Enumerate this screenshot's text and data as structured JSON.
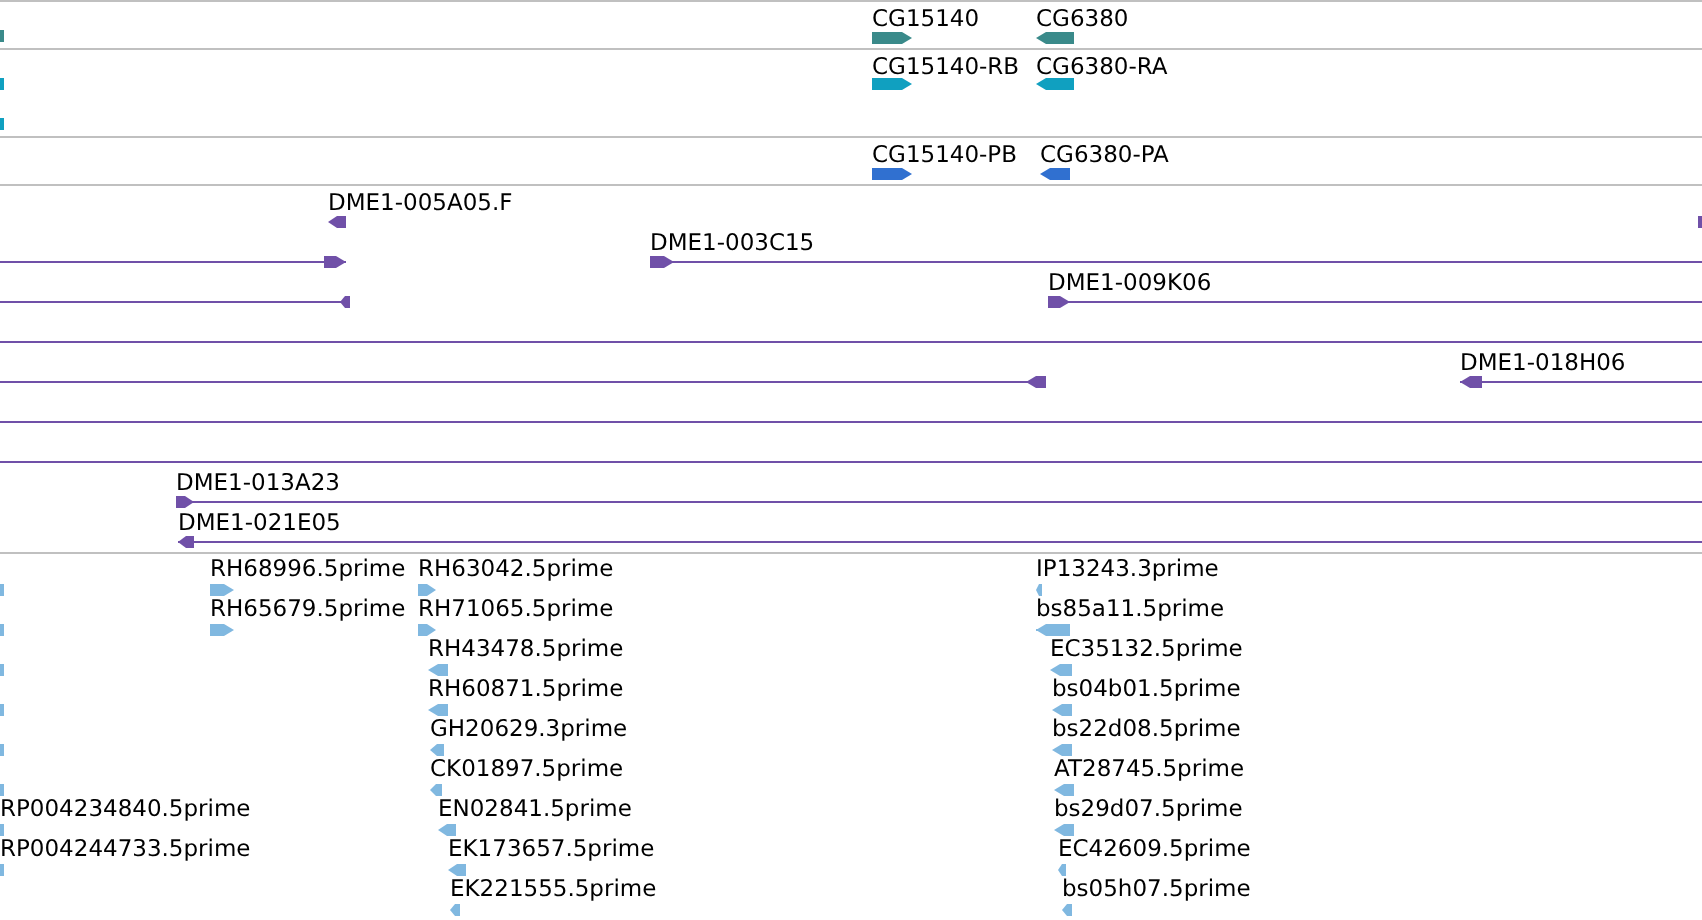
{
  "tracks": [
    {
      "kind": "gene",
      "features": [
        {
          "kind": "stub"
        },
        {
          "kind": "arrow",
          "label": "CG15140",
          "reverse": false
        },
        {
          "kind": "arrow",
          "label": "CG6380",
          "reverse": true
        }
      ]
    },
    {
      "kind": "transcript",
      "features": [
        {
          "kind": "stub"
        },
        {
          "kind": "stub"
        },
        {
          "kind": "arrow",
          "label": "CG15140-RB",
          "reverse": false
        },
        {
          "kind": "arrow",
          "label": "CG6380-RA",
          "reverse": true
        }
      ]
    },
    {
      "kind": "protein",
      "features": [
        {
          "kind": "arrow",
          "label": "CG15140-PB",
          "reverse": false
        },
        {
          "kind": "arrow",
          "label": "CG6380-PA",
          "reverse": true
        }
      ]
    },
    {
      "kind": "clone",
      "features": [
        {
          "kind": "arrow",
          "label": "DME1-005A05.F",
          "reverse": true
        },
        {
          "kind": "stub"
        },
        {
          "kind": "arrow",
          "reverse": false
        },
        {
          "kind": "arrow",
          "label": "DME1-003C15",
          "reverse": false
        },
        {
          "kind": "arrow",
          "reverse": true
        },
        {
          "kind": "arrow",
          "label": "DME1-009K06",
          "reverse": false
        },
        {
          "kind": "span"
        },
        {
          "kind": "arrow",
          "reverse": true
        },
        {
          "kind": "arrow",
          "label": "DME1-018H06",
          "reverse": true
        },
        {
          "kind": "span"
        },
        {
          "kind": "span"
        },
        {
          "kind": "arrow",
          "label": "DME1-013A23",
          "reverse": false
        },
        {
          "kind": "arrow",
          "label": "DME1-021E05",
          "reverse": true
        }
      ]
    },
    {
      "kind": "est",
      "features": [
        {
          "kind": "stub"
        },
        {
          "kind": "stub"
        },
        {
          "kind": "stub"
        },
        {
          "kind": "stub"
        },
        {
          "kind": "stub"
        },
        {
          "kind": "stub"
        },
        {
          "kind": "stub",
          "label": "RP004234840.5prime"
        },
        {
          "kind": "stub",
          "label": "RP004244733.5prime"
        },
        {
          "kind": "arrow",
          "label": "RH68996.5prime",
          "reverse": false
        },
        {
          "kind": "arrow",
          "label": "RH65679.5prime",
          "reverse": false
        },
        {
          "kind": "arrow",
          "label": "RH63042.5prime",
          "reverse": false
        },
        {
          "kind": "arrow",
          "label": "RH71065.5prime",
          "reverse": false
        },
        {
          "kind": "arrow",
          "label": "RH43478.5prime",
          "reverse": true
        },
        {
          "kind": "arrow",
          "label": "RH60871.5prime",
          "reverse": true
        },
        {
          "kind": "arrow",
          "label": "GH20629.3prime",
          "reverse": true
        },
        {
          "kind": "arrow",
          "label": "CK01897.5prime",
          "reverse": true
        },
        {
          "kind": "arrow",
          "label": "EN02841.5prime",
          "reverse": true
        },
        {
          "kind": "arrow",
          "label": "EK173657.5prime",
          "reverse": true
        },
        {
          "kind": "arrow",
          "label": "EK221555.5prime",
          "reverse": true
        },
        {
          "kind": "arrow",
          "label": "IP13243.3prime",
          "reverse": true
        },
        {
          "kind": "arrow",
          "label": "bs85a11.5prime",
          "reverse": true
        },
        {
          "kind": "arrow",
          "label": "EC35132.5prime",
          "reverse": true
        },
        {
          "kind": "arrow",
          "label": "bs04b01.5prime",
          "reverse": true
        },
        {
          "kind": "arrow",
          "label": "bs22d08.5prime",
          "reverse": true
        },
        {
          "kind": "arrow",
          "label": "AT28745.5prime",
          "reverse": true
        },
        {
          "kind": "arrow",
          "label": "bs29d07.5prime",
          "reverse": true
        },
        {
          "kind": "arrow",
          "label": "EC42609.5prime",
          "reverse": true
        },
        {
          "kind": "arrow",
          "label": "bs05h07.5prime",
          "reverse": true
        }
      ]
    }
  ]
}
